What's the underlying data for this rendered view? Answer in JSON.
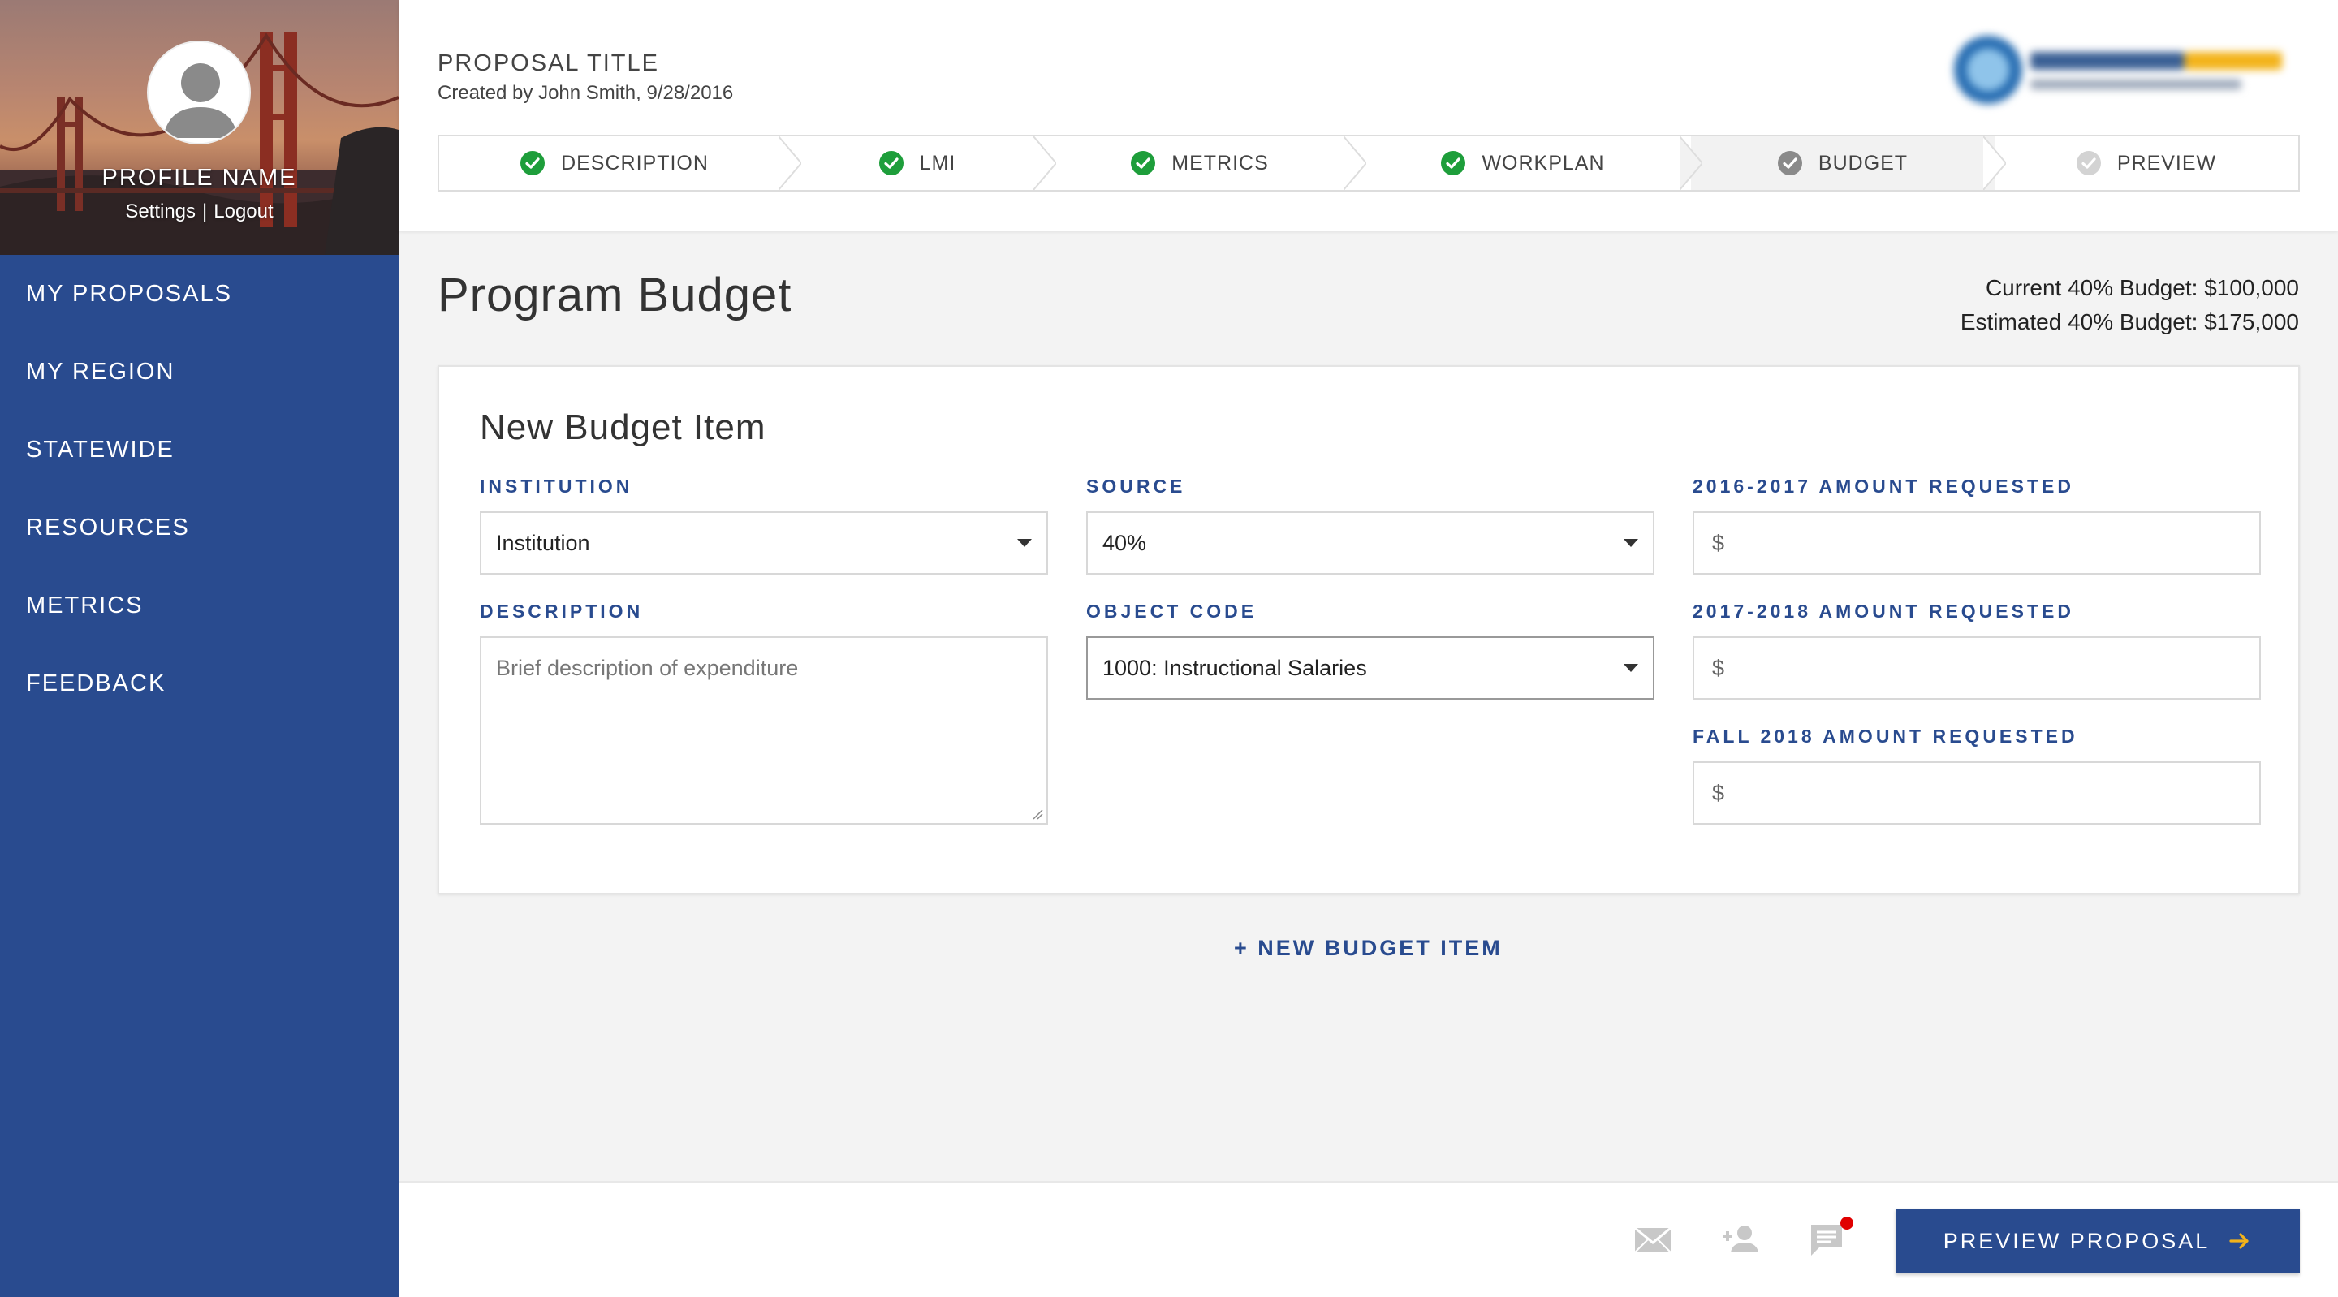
{
  "sidebar": {
    "profile_name": "PROFILE NAME",
    "settings_label": "Settings",
    "separator": "|",
    "logout_label": "Logout",
    "nav": [
      {
        "label": "MY PROPOSALS"
      },
      {
        "label": "MY REGION"
      },
      {
        "label": "STATEWIDE"
      },
      {
        "label": "RESOURCES"
      },
      {
        "label": "METRICS"
      },
      {
        "label": "FEEDBACK"
      }
    ]
  },
  "header": {
    "proposal_title": "PROPOSAL TITLE",
    "created_by": "Created by John Smith, 9/28/2016",
    "steps": [
      {
        "label": "DESCRIPTION",
        "status": "complete"
      },
      {
        "label": "LMI",
        "status": "complete"
      },
      {
        "label": "METRICS",
        "status": "complete"
      },
      {
        "label": "WORKPLAN",
        "status": "complete"
      },
      {
        "label": "BUDGET",
        "status": "current"
      },
      {
        "label": "PREVIEW",
        "status": "pending"
      }
    ]
  },
  "main": {
    "page_title": "Program Budget",
    "current_budget": "Current 40% Budget: $100,000",
    "estimated_budget": "Estimated 40% Budget: $175,000",
    "card": {
      "title": "New Budget Item",
      "institution_label": "INSTITUTION",
      "institution_value": "Institution",
      "source_label": "SOURCE",
      "source_value": "40%",
      "amount_2016_label": "2016-2017 AMOUNT REQUESTED",
      "amount_2016_value": "$",
      "description_label": "DESCRIPTION",
      "description_placeholder": "Brief description of expenditure",
      "object_code_label": "OBJECT CODE",
      "object_code_value": "1000: Instructional Salaries",
      "amount_2017_label": "2017-2018 AMOUNT REQUESTED",
      "amount_2017_value": "$",
      "amount_fall2018_label": "FALL 2018 AMOUNT REQUESTED",
      "amount_fall2018_value": "$"
    },
    "new_budget_item": "+ NEW BUDGET ITEM"
  },
  "footer": {
    "preview_button": "PREVIEW PROPOSAL",
    "icons": [
      "mail-icon",
      "add-person-icon",
      "chat-icon"
    ],
    "notification_color": "#e00000"
  },
  "colors": {
    "brand": "#294b8f",
    "check_green": "#1e9e3b",
    "check_grey": "#8a8a8a"
  }
}
